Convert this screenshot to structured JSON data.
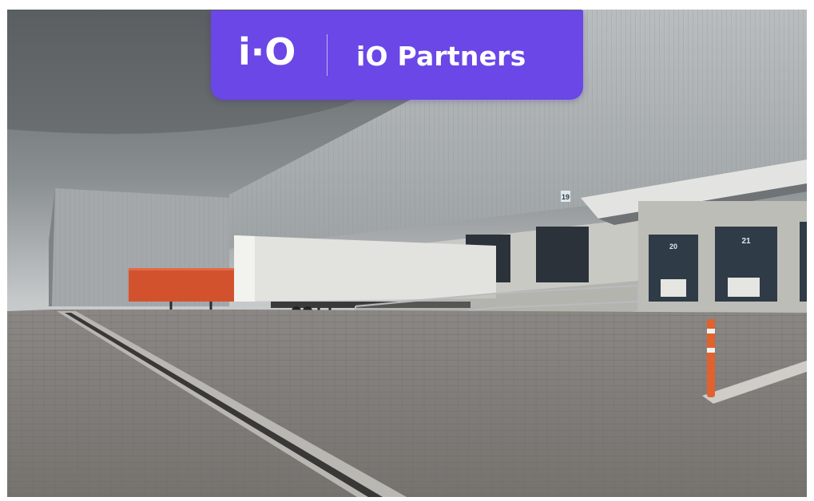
{
  "brand": {
    "logo_text": "i·O",
    "name": "iO Partners",
    "color": "#6a47e6"
  },
  "photo": {
    "dock_numbers": [
      "19",
      "20",
      "21"
    ]
  }
}
